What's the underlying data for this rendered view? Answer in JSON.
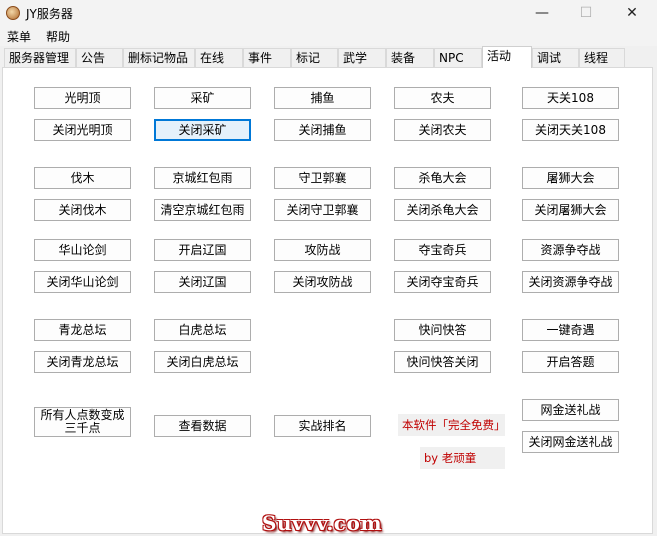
{
  "window": {
    "title": "JY服务器",
    "minimize": "—",
    "maximize": "☐",
    "close": "✕"
  },
  "menu": [
    "菜单",
    "帮助"
  ],
  "tabs": [
    "服务器管理",
    "公告",
    "删标记物品",
    "在线",
    "事件",
    "标记",
    "武学",
    "装备",
    "NPC",
    "活动",
    "调试",
    "线程"
  ],
  "active_tab": "活动",
  "buttons": {
    "r1": [
      "光明顶",
      "采矿",
      "捕鱼",
      "农夫",
      "天关108"
    ],
    "r2": [
      "关闭光明顶",
      "关闭采矿",
      "关闭捕鱼",
      "关闭农夫",
      "关闭天关108"
    ],
    "r3": [
      "伐木",
      "京城红包雨",
      "守卫郭襄",
      "杀龟大会",
      "屠狮大会"
    ],
    "r4": [
      "关闭伐木",
      "清空京城红包雨",
      "关闭守卫郭襄",
      "关闭杀龟大会",
      "关闭屠狮大会"
    ],
    "r5": [
      "华山论剑",
      "开启辽国",
      "攻防战",
      "夺宝奇兵",
      "资源争夺战"
    ],
    "r6": [
      "关闭华山论剑",
      "关闭辽国",
      "关闭攻防战",
      "关闭夺宝奇兵",
      "关闭资源争夺战"
    ],
    "r7": [
      "青龙总坛",
      "白虎总坛",
      "快问快答",
      "一键奇遇"
    ],
    "r8": [
      "关闭青龙总坛",
      "关闭白虎总坛",
      "快问快答关闭",
      "开启答题"
    ],
    "r9": [
      "所有人点数变成三千点",
      "查看数据",
      "实战排名"
    ],
    "gift": [
      "网金送礼战",
      "关闭网金送礼战"
    ]
  },
  "notes": {
    "free": "本软件「完全免费」",
    "author": "by 老顽童"
  },
  "watermark": "Suvvv.com"
}
